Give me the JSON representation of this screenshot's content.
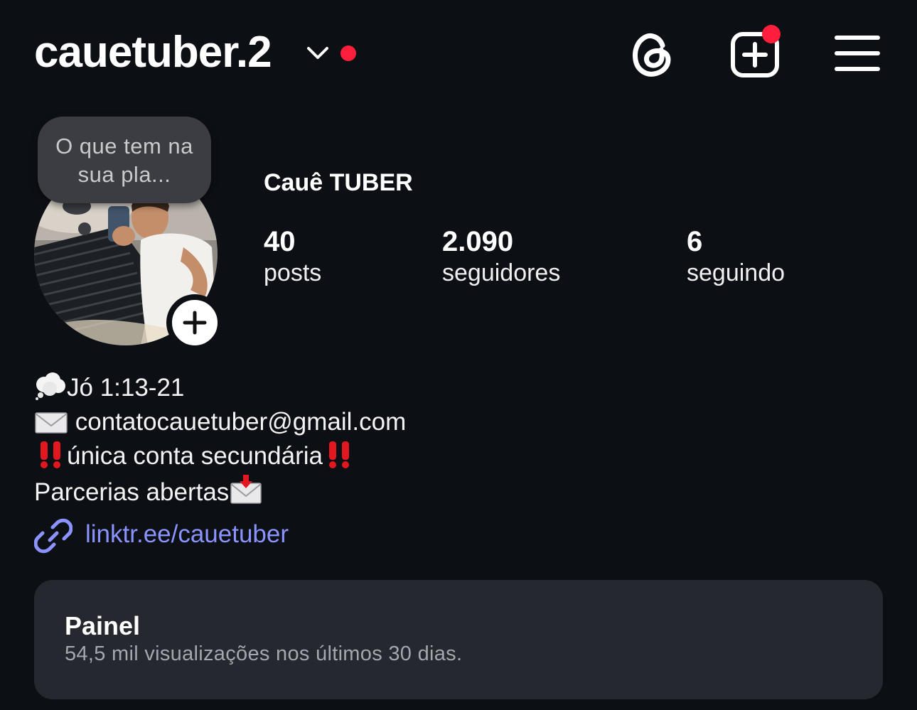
{
  "header": {
    "username": "cauetuber.2",
    "icons": {
      "switch": "chevron-down-icon",
      "threads": "threads-icon",
      "create": "create-post-icon",
      "menu": "hamburger-menu-icon"
    },
    "notification_color": "#ff1f3d"
  },
  "note": {
    "text": "O que tem na sua pla..."
  },
  "profile": {
    "display_name": "Cauê TUBER",
    "stats": [
      {
        "value": "40",
        "label": "posts"
      },
      {
        "value": "2.090",
        "label": "seguidores"
      },
      {
        "value": "6",
        "label": "seguindo"
      }
    ]
  },
  "bio": {
    "line1": "Jó 1:13-21",
    "line2": "contatocauetuber@gmail.com",
    "line3": "única conta secundária",
    "line4": "Parcerias abertas",
    "link": "linktr.ee/cauetuber",
    "link_color": "#8a93ff"
  },
  "dashboard": {
    "title": "Painel",
    "subtitle": "54,5 mil visualizações nos últimos 30 dias."
  }
}
